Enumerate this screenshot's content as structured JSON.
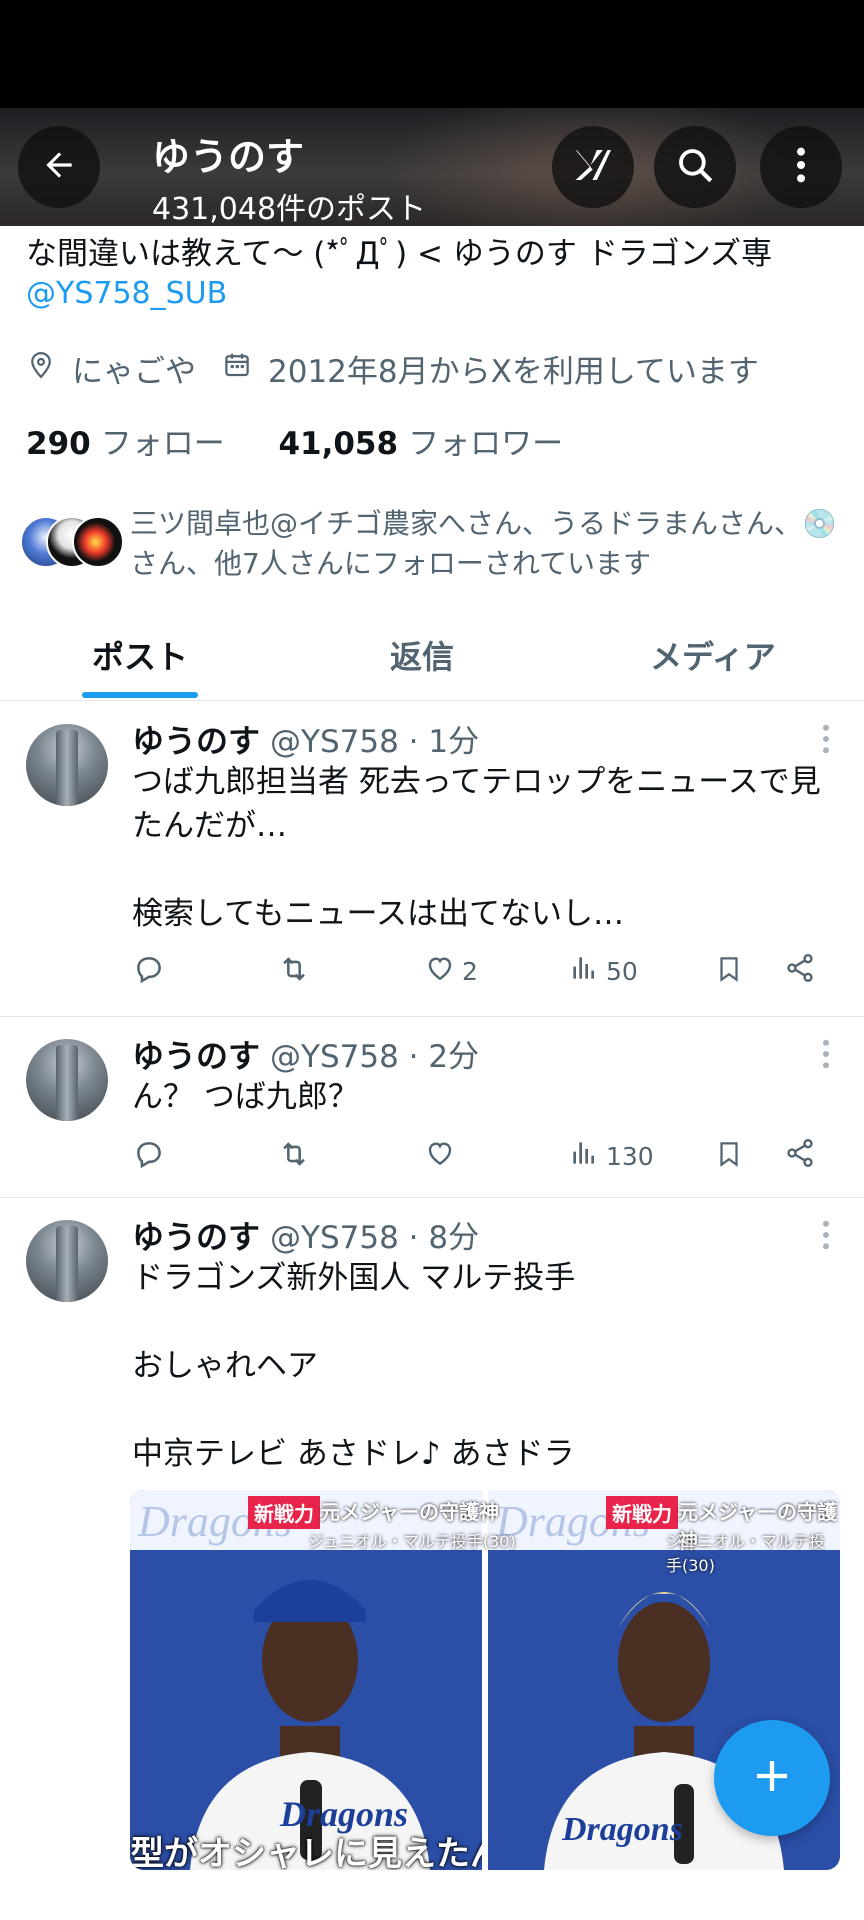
{
  "header": {
    "title": "ゆうのす",
    "post_count": "431,048件のポスト",
    "back_icon": "arrow-left-icon",
    "grok_icon": "grok-icon",
    "search_icon": "search-icon",
    "more_icon": "more-vertical-icon"
  },
  "profile": {
    "bio_line": "な間違いは教えて〜 (*ﾟДﾟ) < ゆうのす ドラゴンズ専",
    "bio_link": "@YS758_SUB",
    "location": "にゃごや",
    "joined": "2012年8月からXを利用しています",
    "following_count": "290",
    "following_label": "フォロー",
    "followers_count": "41,058",
    "followers_label": "フォロワー",
    "followed_by": "三ツ間卓也@イチゴ農家へさん、うるドラまんさん、💿さん、他7人さんにフォローされています"
  },
  "tabs": [
    {
      "label": "ポスト",
      "active": true
    },
    {
      "label": "返信",
      "active": false
    },
    {
      "label": "メディア",
      "active": false
    }
  ],
  "posts": [
    {
      "name": "ゆうのす",
      "handle": "@YS758 · 1分",
      "text": "つば九郎担当者 死去ってテロップをニュースで見たんだが…\n\n検索してもニュースは出てないし…",
      "likes": "2",
      "views": "50"
    },
    {
      "name": "ゆうのす",
      "handle": "@YS758 · 2分",
      "text": "ん？ つば九郎？",
      "likes": "",
      "views": "130"
    },
    {
      "name": "ゆうのす",
      "handle": "@YS758 · 8分",
      "text": "ドラゴンズ新外国人 マルテ投手\n\nおしゃれヘア\n\n中京テレビ あさドレ♪ あさドラ",
      "likes": "",
      "views": ""
    }
  ],
  "media": {
    "badge": "新戦力",
    "headline": "元メジャーの守護神",
    "caption": "ジュニオル・マルテ投手(30)",
    "subtitle": "型がオシャレに見えたんで"
  },
  "colors": {
    "accent": "#1d9bf0",
    "text": "#0f1419",
    "muted": "#536471"
  }
}
